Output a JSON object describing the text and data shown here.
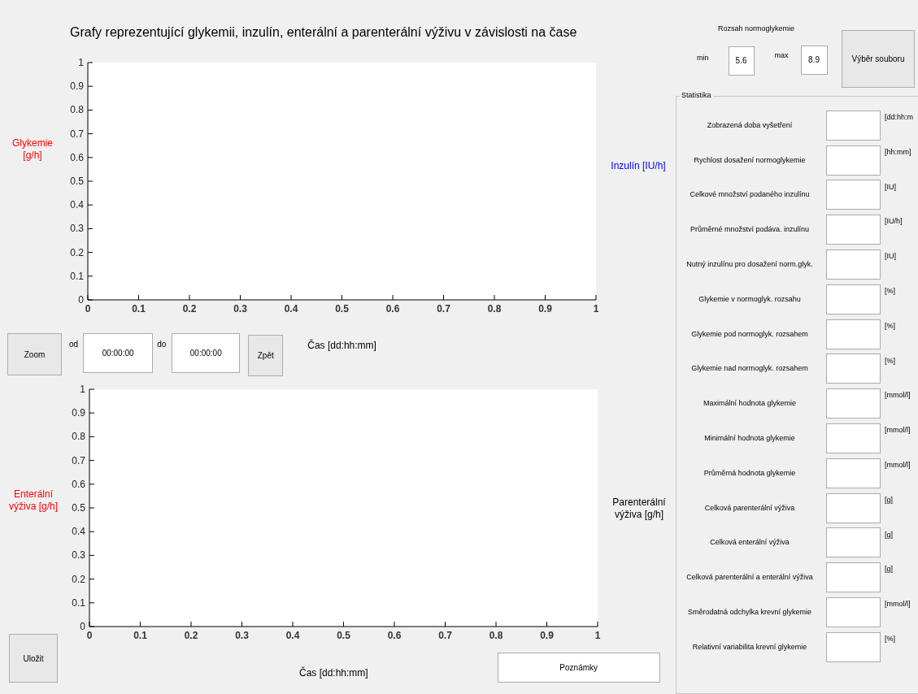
{
  "title": "Grafy reprezentující glykemii, inzulín, enterální a parenterální výživu v závislosti na čase",
  "charts": [
    {
      "left_label": "Glykemie [g/h]",
      "right_label": "Inzulín [IU/h]",
      "xlabel": "Čas [dd:hh:mm]",
      "chart_data": {
        "type": "line",
        "xlim": [
          0,
          1
        ],
        "ylim": [
          0,
          1
        ],
        "xticks": [
          0,
          0.1,
          0.2,
          0.3,
          0.4,
          0.5,
          0.6,
          0.7,
          0.8,
          0.9,
          1
        ],
        "yticks": [
          0,
          0.1,
          0.2,
          0.3,
          0.4,
          0.5,
          0.6,
          0.7,
          0.8,
          0.9,
          1
        ]
      }
    },
    {
      "left_label": "Enterální výživa [g/h]",
      "right_label": "Parenterální výživa [g/h]",
      "xlabel": "Čas [dd:hh:mm]",
      "chart_data": {
        "type": "line",
        "xlim": [
          0,
          1
        ],
        "ylim": [
          0,
          1
        ],
        "xticks": [
          0,
          0.1,
          0.2,
          0.3,
          0.4,
          0.5,
          0.6,
          0.7,
          0.8,
          0.9,
          1
        ],
        "yticks": [
          0,
          0.1,
          0.2,
          0.3,
          0.4,
          0.5,
          0.6,
          0.7,
          0.8,
          0.9,
          1
        ]
      }
    }
  ],
  "zoom": {
    "button": "Zoom",
    "from_label": "od",
    "from_value": "00:00:00",
    "to_label": "do",
    "to_value": "00:00:00",
    "back_button": "Zpět"
  },
  "save_button": "Uložit",
  "notes_button": "Poznámky",
  "range": {
    "title": "Rozsah normoglykemie",
    "min_label": "min",
    "min_value": "5.6",
    "max_label": "max",
    "max_value": "8.9"
  },
  "file_button": "Výběr souboru",
  "statistics": {
    "title": "Statistika",
    "rows": [
      {
        "label": "Zobrazená doba vyšetření",
        "unit": "[dd:hh:m"
      },
      {
        "label": "Rychlost dosažení normoglykemie",
        "unit": "[hh:mm]"
      },
      {
        "label": "Celkové množství podaného inzulínu",
        "unit": "[IU]"
      },
      {
        "label": "Průměrné množství podáva. inzulínu",
        "unit": "[IU/h]"
      },
      {
        "label": "Nutný inzulínu pro dosažení norm.glyk.",
        "unit": "[IU]"
      },
      {
        "label": "Glykemie v normoglyk. rozsahu",
        "unit": "[%]"
      },
      {
        "label": "Glykemie pod normoglyk. rozsahem",
        "unit": "[%]"
      },
      {
        "label": "Glykemie nad normoglyk. rozsahem",
        "unit": "[%]"
      },
      {
        "label": "Maximální hodnota glykemie",
        "unit": "[mmol/l]"
      },
      {
        "label": "Minimální hodnota glykemie",
        "unit": "[mmol/l]"
      },
      {
        "label": "Průměrná hodnota glykemie",
        "unit": "[mmol/l]"
      },
      {
        "label": "Celková parenterální výživa",
        "unit": "[g]"
      },
      {
        "label": "Celková enterální výživa",
        "unit": "[g]"
      },
      {
        "label": "Celková parenterální a enterální výživa",
        "unit": "[g]"
      },
      {
        "label": "Směrodatná odchylka krevní glykemie",
        "unit": "[mmol/l]"
      },
      {
        "label": "Relativní variabilita krevní glykemie",
        "unit": "[%]"
      }
    ]
  }
}
